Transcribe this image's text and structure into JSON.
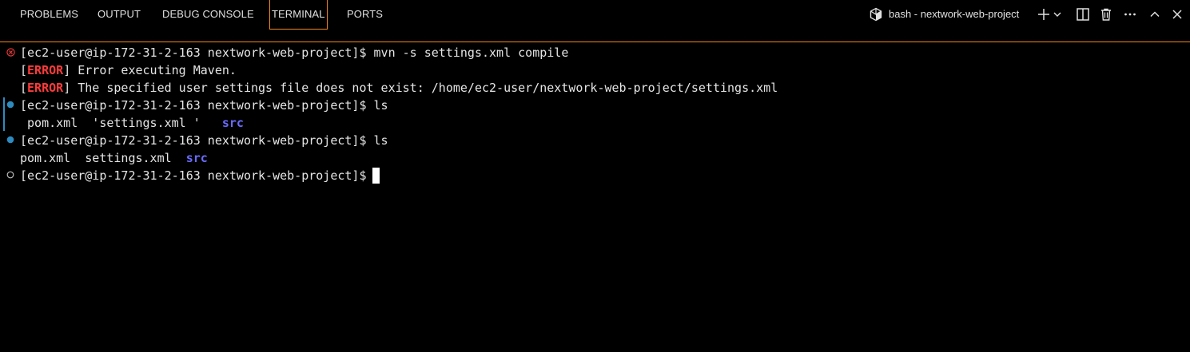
{
  "panel": {
    "tabs": [
      {
        "label": "PROBLEMS"
      },
      {
        "label": "OUTPUT"
      },
      {
        "label": "DEBUG CONSOLE"
      },
      {
        "label": "TERMINAL"
      },
      {
        "label": "PORTS"
      }
    ],
    "active_tab": "TERMINAL",
    "terminal_title": "bash - nextwork-web-project"
  },
  "terminal": {
    "prompt": "[ec2-user@ip-172-31-2-163 nextwork-web-project]$",
    "lines": [
      {
        "prompt": "[ec2-user@ip-172-31-2-163 nextwork-web-project]$",
        "command": " mvn -s settings.xml compile",
        "status": "error"
      },
      {
        "open": "[",
        "tag": "ERROR",
        "close": "]",
        "message": " Error executing Maven."
      },
      {
        "open": "[",
        "tag": "ERROR",
        "close": "]",
        "message": " The specified user settings file does not exist: /home/ec2-user/nextwork-web-project/settings.xml"
      },
      {
        "prompt": "[ec2-user@ip-172-31-2-163 nextwork-web-project]$",
        "command": " ls",
        "status": "success"
      },
      {
        "files": " pom.xml  'settings.xml '   ",
        "dir": "src"
      },
      {
        "prompt": "[ec2-user@ip-172-31-2-163 nextwork-web-project]$",
        "command": " ls",
        "status": "success"
      },
      {
        "files": "pom.xml  settings.xml  ",
        "dir": "src"
      },
      {
        "prompt": "[ec2-user@ip-172-31-2-163 nextwork-web-project]$",
        "command": " ",
        "status": "pending"
      }
    ]
  },
  "colors": {
    "focus_border": "#f38518",
    "error": "#ff3b3b",
    "directory": "#6b6bff",
    "success_dot": "#2e8bc0"
  },
  "icons": {
    "terminal": "terminal-profile-icon",
    "new_terminal": "plus-icon",
    "dropdown": "chevron-down-icon",
    "split": "split-icon",
    "trash": "trash-icon",
    "more": "ellipsis-icon",
    "maximize": "chevron-up-icon",
    "close": "close-icon"
  }
}
